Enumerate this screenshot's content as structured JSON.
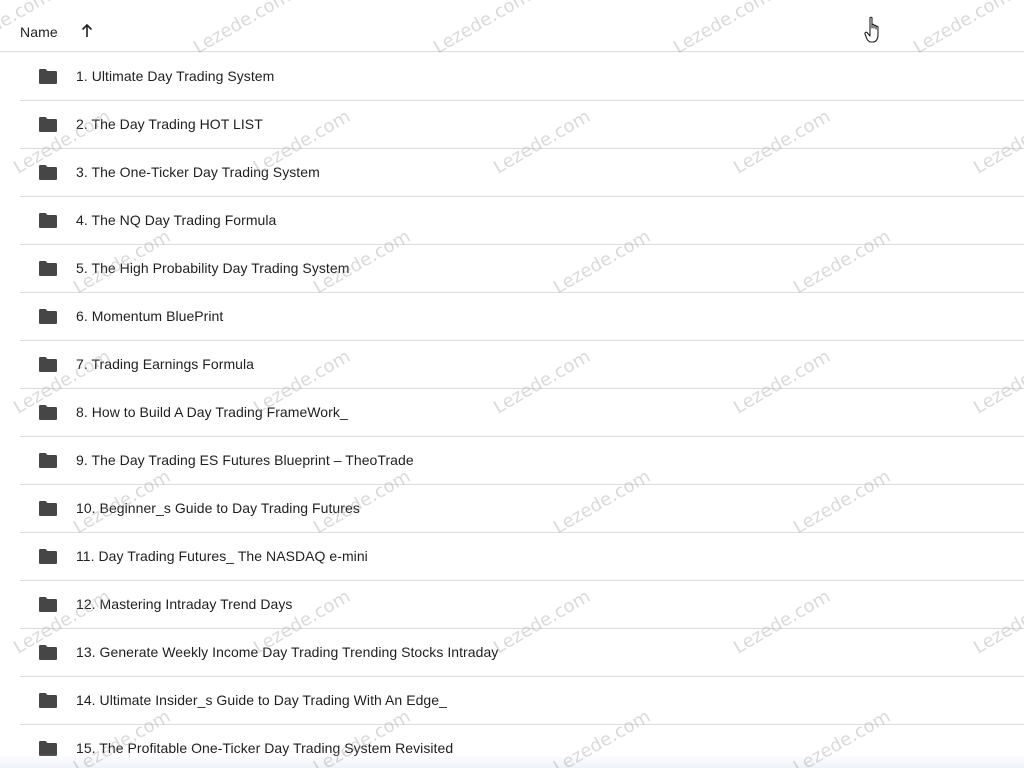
{
  "header": {
    "name_label": "Name",
    "sort_direction": "ascending"
  },
  "rows": [
    {
      "label": "1. Ultimate Day Trading System",
      "icon": "folder-icon"
    },
    {
      "label": "2. The Day Trading HOT LIST",
      "icon": "folder-icon"
    },
    {
      "label": "3. The One-Ticker Day Trading System",
      "icon": "folder-icon"
    },
    {
      "label": "4. The NQ Day Trading Formula",
      "icon": "folder-icon"
    },
    {
      "label": "5. The High Probability Day Trading System",
      "icon": "folder-icon"
    },
    {
      "label": "6. Momentum BluePrint",
      "icon": "folder-icon"
    },
    {
      "label": "7. Trading Earnings Formula",
      "icon": "folder-icon"
    },
    {
      "label": "8. How to Build A Day Trading FrameWork_",
      "icon": "folder-icon"
    },
    {
      "label": "9. The Day Trading ES Futures Blueprint – TheoTrade",
      "icon": "folder-icon"
    },
    {
      "label": "10. Beginner_s Guide to Day Trading Futures",
      "icon": "folder-icon"
    },
    {
      "label": "11. Day Trading Futures_ The NASDAQ e-mini",
      "icon": "folder-icon"
    },
    {
      "label": "12. Mastering Intraday Trend Days",
      "icon": "folder-icon"
    },
    {
      "label": "13. Generate Weekly Income Day Trading Trending Stocks Intraday",
      "icon": "folder-icon"
    },
    {
      "label": "14. Ultimate Insider_s Guide to Day Trading With An Edge_",
      "icon": "folder-icon"
    },
    {
      "label": "15. The Profitable One-Ticker Day Trading System Revisited",
      "icon": "folder-icon"
    }
  ],
  "watermark": {
    "text": "Lezede.com"
  },
  "colors": {
    "text": "#1f1f1f",
    "divider": "#dadce0",
    "icon": "#444746"
  }
}
